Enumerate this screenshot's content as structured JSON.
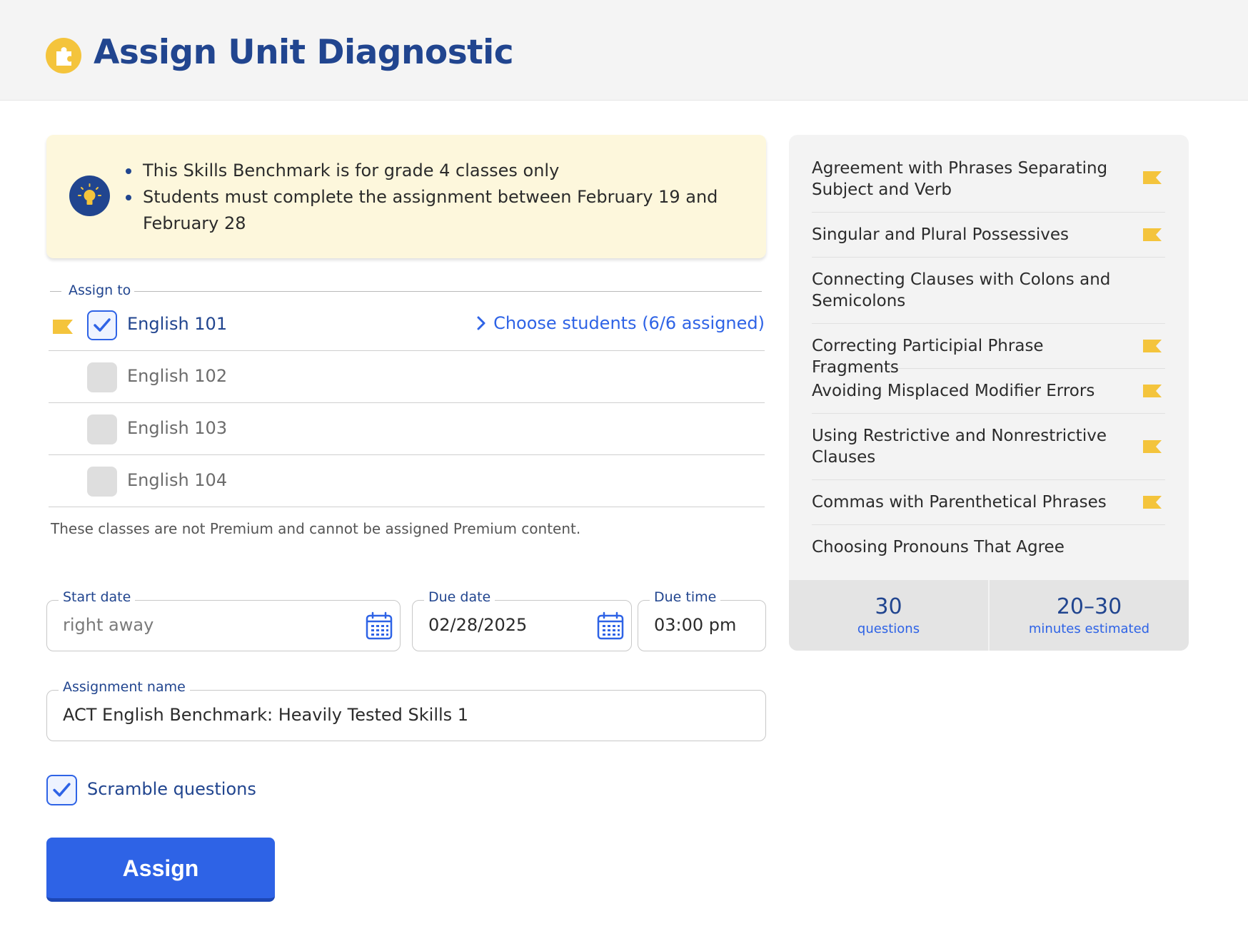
{
  "header": {
    "title": "Assign Unit Diagnostic",
    "icon": "puzzle-icon"
  },
  "banner": {
    "icon": "lightbulb-icon",
    "items": [
      "This Skills Benchmark is for grade 4 classes only",
      "Students must complete the assignment between February 19 and February 28"
    ]
  },
  "assign_to": {
    "legend": "Assign to",
    "classes": [
      {
        "name": "English 101",
        "checked": true,
        "flagged": true
      },
      {
        "name": "English 102",
        "checked": false,
        "flagged": false
      },
      {
        "name": "English 103",
        "checked": false,
        "flagged": false
      },
      {
        "name": "English 104",
        "checked": false,
        "flagged": false
      }
    ],
    "choose_students": "Choose students (6/6 assigned)",
    "note": "These classes are not Premium and cannot be assigned Premium content."
  },
  "fields": {
    "start_date": {
      "label": "Start date",
      "placeholder": "right away"
    },
    "due_date": {
      "label": "Due date",
      "value": "02/28/2025"
    },
    "due_time": {
      "label": "Due time",
      "value": "03:00 pm"
    },
    "assignment_name": {
      "label": "Assignment name",
      "value": "ACT English Benchmark: Heavily Tested Skills 1"
    }
  },
  "scramble": {
    "label": "Scramble questions",
    "checked": true
  },
  "assign_button": "Assign",
  "skills": [
    {
      "text": "Agreement with Phrases Separating Subject and Verb",
      "flagged": true
    },
    {
      "text": "Singular and Plural Possessives",
      "flagged": true
    },
    {
      "text": "Connecting Clauses with Colons and Semicolons",
      "flagged": false
    },
    {
      "text": "Correcting Participial Phrase Fragments",
      "flagged": true
    },
    {
      "text": "Avoiding Misplaced Modifier Errors",
      "flagged": true
    },
    {
      "text": "Using Restrictive and Nonrestrictive Clauses",
      "flagged": true
    },
    {
      "text": "Commas with Parenthetical Phrases",
      "flagged": true
    },
    {
      "text": "Choosing Pronouns That Agree",
      "flagged": false
    }
  ],
  "stats": {
    "questions": {
      "value": "30",
      "label": "questions"
    },
    "minutes": {
      "value": "20–30",
      "label": "minutes estimated"
    }
  },
  "colors": {
    "brand_navy": "#21458f",
    "accent_blue": "#2e63e6",
    "flag_yellow": "#f4c43c",
    "banner_bg": "#fdf7dc"
  }
}
